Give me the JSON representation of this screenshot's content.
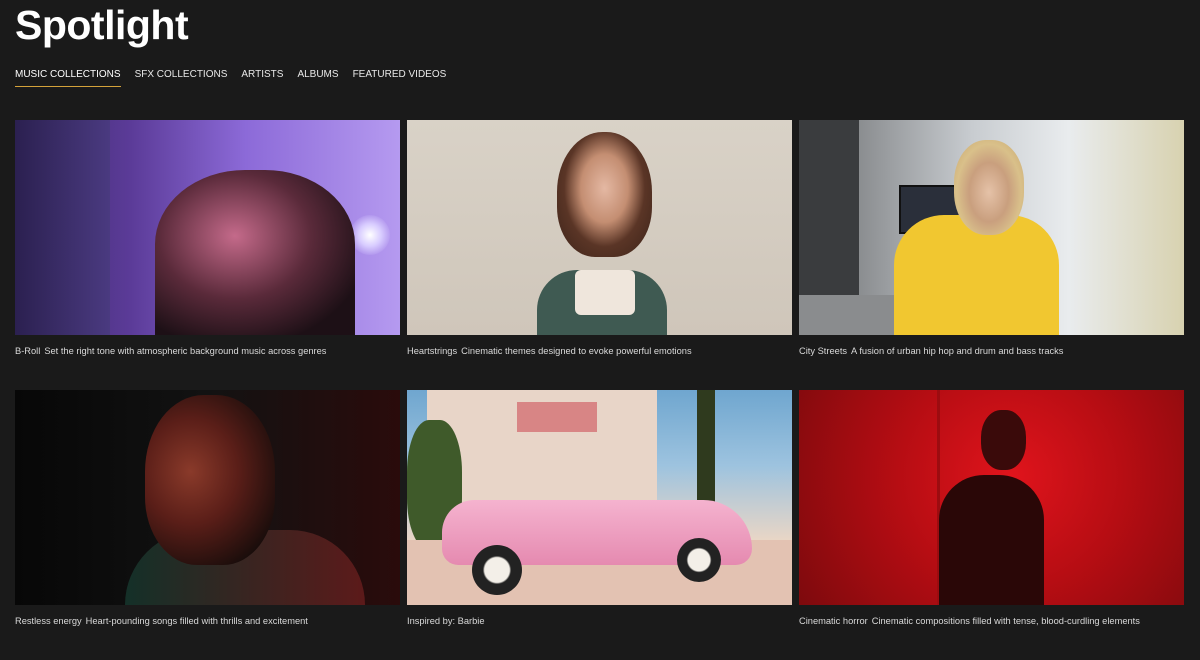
{
  "page": {
    "title": "Spotlight"
  },
  "tabs": [
    {
      "label": "MUSIC COLLECTIONS",
      "active": true
    },
    {
      "label": "SFX COLLECTIONS",
      "active": false
    },
    {
      "label": "ARTISTS",
      "active": false
    },
    {
      "label": "ALBUMS",
      "active": false
    },
    {
      "label": "FEATURED VIDEOS",
      "active": false
    }
  ],
  "collections": [
    {
      "name": "B-Roll",
      "description": "Set the right tone with atmospheric background music across genres"
    },
    {
      "name": "Heartstrings",
      "description": "Cinematic themes designed to evoke powerful emotions"
    },
    {
      "name": "City Streets",
      "description": "A fusion of urban hip hop and drum and bass tracks"
    },
    {
      "name": "Restless energy",
      "description": "Heart-pounding songs filled with thrills and excitement"
    },
    {
      "name": "Inspired by: Barbie",
      "description": ""
    },
    {
      "name": "Cinematic horror",
      "description": "Cinematic compositions filled with tense, blood-curdling elements"
    }
  ],
  "colors": {
    "accent": "#d4a23a",
    "background": "#1a1a1a"
  }
}
